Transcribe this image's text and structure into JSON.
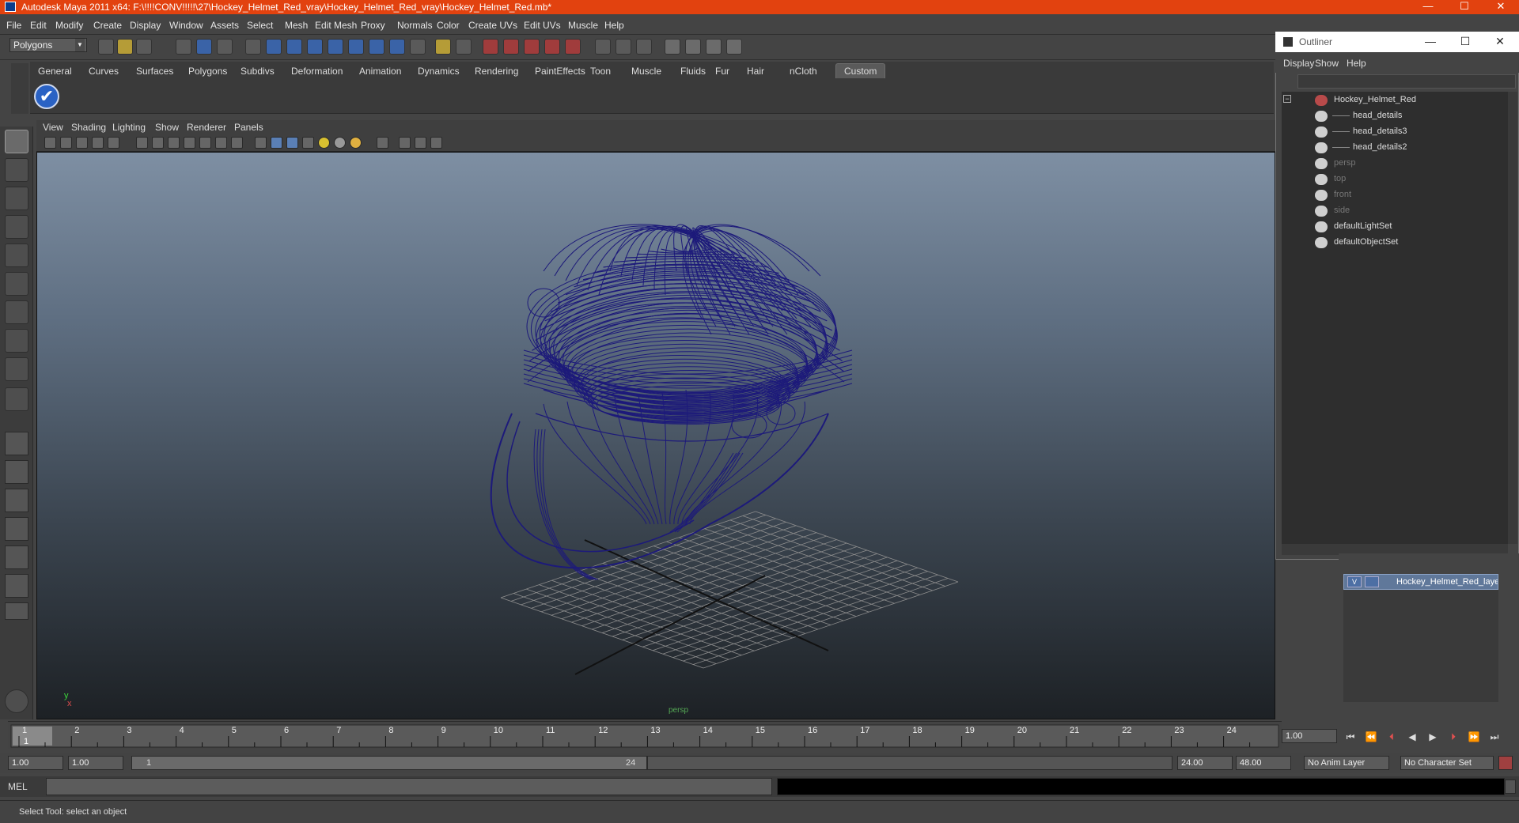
{
  "window": {
    "title": "Autodesk Maya 2011 x64: F:\\!!!!CONV!!!!!\\27\\Hockey_Helmet_Red_vray\\Hockey_Helmet_Red_vray\\Hockey_Helmet_Red.mb*",
    "min": "—",
    "max": "☐",
    "close": "✕"
  },
  "menus": [
    "File",
    "Edit",
    "Modify",
    "Create",
    "Display",
    "Window",
    "Assets",
    "Select",
    "Mesh",
    "Edit Mesh",
    "Proxy",
    "Normals",
    "Color",
    "Create UVs",
    "Edit UVs",
    "Muscle",
    "Help"
  ],
  "mode": "Polygons",
  "shelf_tabs": [
    "General",
    "Curves",
    "Surfaces",
    "Polygons",
    "Subdivs",
    "Deformation",
    "Animation",
    "Dynamics",
    "Rendering",
    "PaintEffects",
    "Toon",
    "Muscle",
    "Fluids",
    "Fur",
    "Hair",
    "nCloth",
    "Custom"
  ],
  "active_shelf": "Custom",
  "panel_menus": [
    "View",
    "Shading",
    "Lighting",
    "Show",
    "Renderer",
    "Panels"
  ],
  "viewport": {
    "axis_y": "y",
    "axis_x": "x",
    "camera_label": "persp"
  },
  "timeline": {
    "ticks": [
      "1",
      "2",
      "3",
      "4",
      "5",
      "6",
      "7",
      "8",
      "9",
      "10",
      "11",
      "12",
      "13",
      "14",
      "15",
      "16",
      "17",
      "18",
      "19",
      "20",
      "21",
      "22",
      "23",
      "24"
    ],
    "current_frame_marker": "1",
    "current_frame": "1.00"
  },
  "playback": [
    "⏮",
    "⏭|",
    "|◀",
    "◀",
    "▶",
    "▶|",
    "⏭",
    "⏭|"
  ],
  "range": {
    "start": "1.00",
    "start2": "1.00",
    "inner_start": "1",
    "inner_end": "24",
    "end": "24.00",
    "end2": "48.00",
    "anim_layer": "No Anim Layer",
    "char_set": "No Character Set"
  },
  "command": {
    "label": "MEL"
  },
  "help_line": "Select Tool: select an object",
  "layers": {
    "name": "Hockey_Helmet_Red_layer",
    "visible": "V"
  },
  "outliner": {
    "title": "Outliner",
    "menus": [
      "Display",
      "Show",
      "Help"
    ],
    "items": [
      {
        "label": "Hockey_Helmet_Red",
        "level": 0,
        "dim": false
      },
      {
        "label": "head_details",
        "level": 1,
        "dim": false
      },
      {
        "label": "head_details3",
        "level": 1,
        "dim": false
      },
      {
        "label": "head_details2",
        "level": 1,
        "dim": false
      },
      {
        "label": "persp",
        "level": 0,
        "dim": true
      },
      {
        "label": "top",
        "level": 0,
        "dim": true
      },
      {
        "label": "front",
        "level": 0,
        "dim": true
      },
      {
        "label": "side",
        "level": 0,
        "dim": true
      },
      {
        "label": "defaultLightSet",
        "level": 0,
        "dim": false
      },
      {
        "label": "defaultObjectSet",
        "level": 0,
        "dim": false
      }
    ]
  }
}
